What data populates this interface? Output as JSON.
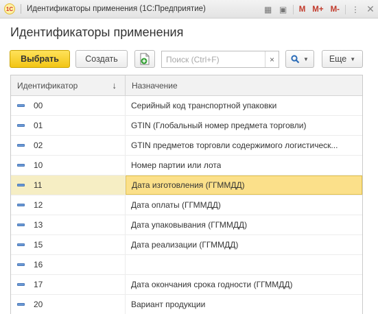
{
  "window": {
    "logo_text": "1С",
    "title": "Идентификаторы применения  (1С:Предприятие)",
    "icons": {
      "table_icon": "▦",
      "calendar_icon": "▣",
      "m_label": "M",
      "m_plus_label": "M+",
      "m_minus_label": "M-",
      "menu_icon": "⋮",
      "close_icon": "✕"
    }
  },
  "form": {
    "title": "Идентификаторы применения"
  },
  "toolbar": {
    "select_label": "Выбрать",
    "create_label": "Создать",
    "add_icon": "+",
    "search_placeholder": "Поиск (Ctrl+F)",
    "search_clear": "×",
    "search_icon": "🔍",
    "more_label": "Еще",
    "caret": "▼"
  },
  "table": {
    "columns": {
      "id": "Идентификатор",
      "sort_icon": "↓",
      "name": "Назначение"
    },
    "rows": [
      {
        "id": "00",
        "name": "Серийный код транспортной упаковки"
      },
      {
        "id": "01",
        "name": "GTIN (Глобальный номер предмета торговли)"
      },
      {
        "id": "02",
        "name": "GTIN предметов торговли содержимого логистическ..."
      },
      {
        "id": "10",
        "name": "Номер партии или лота"
      },
      {
        "id": "11",
        "name": "Дата изготовления (ГГММДД)"
      },
      {
        "id": "12",
        "name": "Дата оплаты (ГГММДД)"
      },
      {
        "id": "13",
        "name": "Дата упаковывания (ГГММДД)"
      },
      {
        "id": "15",
        "name": "Дата реализации (ГГММДД)"
      },
      {
        "id": "16",
        "name": ""
      },
      {
        "id": "17",
        "name": "Дата окончания срока годности (ГГММДД)"
      },
      {
        "id": "20",
        "name": "Вариант продукции"
      }
    ],
    "selected_index": 4
  },
  "colors": {
    "primary_button": "#f2c515",
    "selected_row": "#f6eec4",
    "selected_cell": "#fbe08a",
    "row_icon": "#6b9ad6"
  }
}
